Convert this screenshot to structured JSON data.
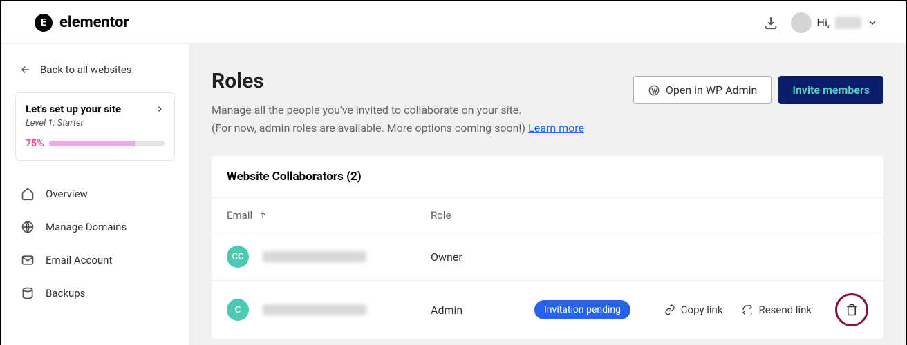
{
  "brand": "elementor",
  "topbar": {
    "greeting": "Hi,"
  },
  "sidebar": {
    "back_label": "Back to all websites",
    "setup": {
      "title": "Let's set up your site",
      "level": "Level 1: Starter",
      "percent": "75%"
    },
    "nav": {
      "overview": "Overview",
      "domains": "Manage Domains",
      "email": "Email Account",
      "backups": "Backups"
    }
  },
  "page": {
    "title": "Roles",
    "desc1": "Manage all the people you've invited to collaborate on your site.",
    "desc2": "(For now, admin roles are available. More options coming soon!) ",
    "learn_more": "Learn more",
    "open_wp": "Open in WP Admin",
    "invite": "Invite members"
  },
  "collab": {
    "heading": "Website Collaborators (2)",
    "cols": {
      "email": "Email",
      "role": "Role"
    },
    "rows": [
      {
        "initials": "CC",
        "role": "Owner"
      },
      {
        "initials": "C",
        "role": "Admin",
        "badge": "Invitation pending"
      }
    ],
    "actions": {
      "copy": "Copy link",
      "resend": "Resend link"
    }
  }
}
